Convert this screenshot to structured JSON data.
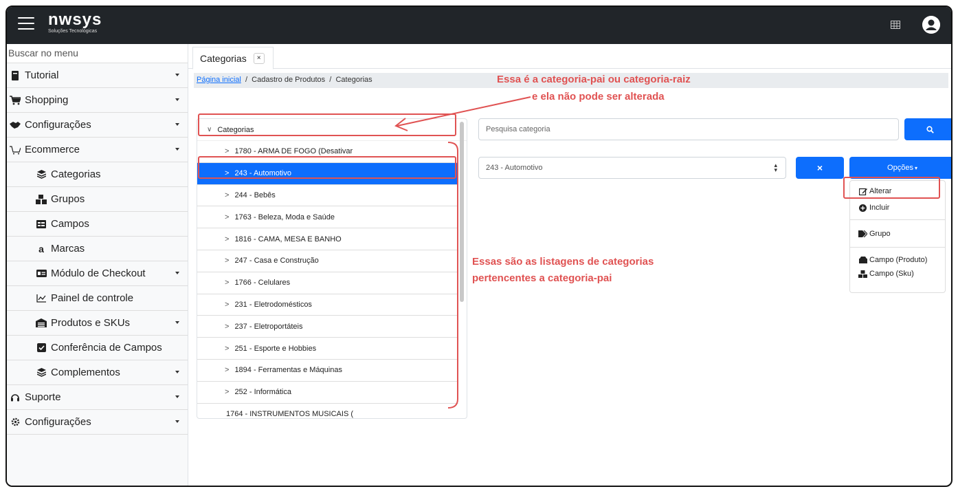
{
  "app": {
    "logo": "nwsys",
    "logo_subtitle": "Soluções Tecnológicas"
  },
  "sidebar": {
    "search_placeholder": "Buscar no menu",
    "items": [
      {
        "label": "Tutorial",
        "icon": "book-icon",
        "has_caret": true
      },
      {
        "label": "Shopping",
        "icon": "cart-icon",
        "has_caret": true
      },
      {
        "label": "Configurações",
        "icon": "handshake-icon",
        "has_caret": true
      },
      {
        "label": "Ecommerce",
        "icon": "ecommerce-cart-icon",
        "has_caret": true
      },
      {
        "label": "Categorias",
        "icon": "layers-icon",
        "has_caret": false
      },
      {
        "label": "Grupos",
        "icon": "cubes-icon",
        "has_caret": false
      },
      {
        "label": "Campos",
        "icon": "table-icon",
        "has_caret": false
      },
      {
        "label": "Marcas",
        "icon": "amazon-icon",
        "has_caret": false
      },
      {
        "label": "Módulo de Checkout",
        "icon": "id-card-icon",
        "has_caret": true
      },
      {
        "label": "Painel de controle",
        "icon": "line-chart-icon",
        "has_caret": false
      },
      {
        "label": "Produtos e SKUs",
        "icon": "warehouse-icon",
        "has_caret": true
      },
      {
        "label": "Conferência de Campos",
        "icon": "checkbox-icon",
        "has_caret": false
      },
      {
        "label": "Complementos",
        "icon": "layers-icon",
        "has_caret": true
      },
      {
        "label": "Suporte",
        "icon": "headset-icon",
        "has_caret": true
      },
      {
        "label": "Configurações",
        "icon": "cog-icon",
        "has_caret": true
      }
    ]
  },
  "tabs": [
    {
      "label": "Categorias",
      "close": "×"
    }
  ],
  "breadcrumb": {
    "home": "Página inicial",
    "sep": "/",
    "parent": "Cadastro de Produtos",
    "current": "Categorias"
  },
  "tree": {
    "root_label": "Categorias",
    "rows": [
      {
        "label": "1780 - ARMA DE FOGO (Desativar",
        "chevron": ">"
      },
      {
        "label": "243 - Automotivo",
        "chevron": ">",
        "selected": true
      },
      {
        "label": "244 - Bebês",
        "chevron": ">"
      },
      {
        "label": "1763 - Beleza, Moda e Saúde",
        "chevron": ">"
      },
      {
        "label": "1816 - CAMA, MESA E BANHO",
        "chevron": ">"
      },
      {
        "label": "247 - Casa e Construção",
        "chevron": ">"
      },
      {
        "label": "1766 - Celulares",
        "chevron": ">"
      },
      {
        "label": "231 - Eletrodomésticos",
        "chevron": ">"
      },
      {
        "label": "237 - Eletroportáteis",
        "chevron": ">"
      },
      {
        "label": "251 - Esporte e Hobbies",
        "chevron": ">"
      },
      {
        "label": "1894 - Ferramentas e Máquinas",
        "chevron": ">"
      },
      {
        "label": "252 - Informática",
        "chevron": ">"
      },
      {
        "label": "1764 - INSTRUMENTOS MUSICAIS (",
        "chevron": ""
      }
    ]
  },
  "search": {
    "placeholder": "Pesquisa categoria"
  },
  "selected_category": "243 - Automotivo",
  "clear_button": "×",
  "options": {
    "label": "Opções",
    "items": [
      {
        "label": "Alterar",
        "icon": "edit-icon"
      },
      {
        "label": "Incluir",
        "icon": "plus-circle-icon"
      },
      {
        "label": "Grupo",
        "icon": "tags-icon"
      },
      {
        "label": "Campo (Produto)",
        "icon": "boxes-icon"
      },
      {
        "label": "Campo (Sku)",
        "icon": "cubes-icon"
      }
    ]
  },
  "annotations": {
    "parent_line1": "Essa é a categoria-pai ou categoria-raiz",
    "parent_line2": "e ela não pode ser alterada",
    "children_line1": "Essas são as listagens de categorias",
    "children_line2": "pertencentes a categoria-pai"
  },
  "colors": {
    "topbar": "#212529",
    "primary": "#0d6efd",
    "annotation": "#e05252"
  }
}
